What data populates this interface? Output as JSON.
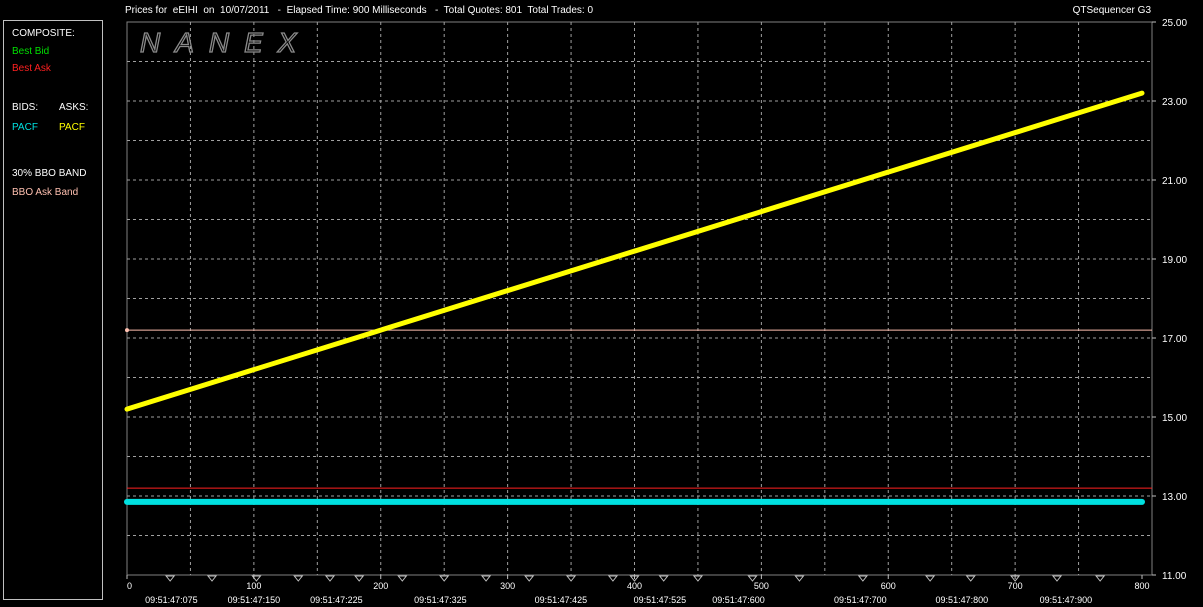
{
  "header": {
    "title": "Prices for  eEIHI  on  10/07/2011   -  Elapsed Time: 900 Milliseconds   -  Total Quotes: 801  Total Trades: 0",
    "app_name": "QTSequencer G3"
  },
  "watermark": "NANEX",
  "legend": {
    "composite_heading": "COMPOSITE:",
    "best_bid": "Best Bid",
    "best_ask": "Best Ask",
    "bids_heading": "BIDS:",
    "asks_heading": "ASKS:",
    "bid_exchange": "PACF",
    "ask_exchange": "PACF",
    "band_heading": "30% BBO BAND",
    "band_item": "BBO Ask Band"
  },
  "colors": {
    "best_bid": "#00e000",
    "best_ask": "#ff2020",
    "bid_series": "#00e0e0",
    "ask_series": "#ffff00",
    "band": "#ffc0b0",
    "grid": "#a0a0a0"
  },
  "chart_data": {
    "type": "line",
    "x_axis_label": "",
    "y_axis_label": "",
    "xlim": [
      0,
      800
    ],
    "ylim": [
      11,
      25
    ],
    "x_ticks": [
      0,
      100,
      200,
      300,
      400,
      500,
      600,
      700,
      800
    ],
    "y_ticks": [
      "11.00",
      "13.00",
      "15.00",
      "17.00",
      "19.00",
      "21.00",
      "23.00",
      "25.00"
    ],
    "time_labels": [
      {
        "x": 35,
        "label": "09:51:47:075"
      },
      {
        "x": 100,
        "label": "09:51:47:150"
      },
      {
        "x": 165,
        "label": "09:51:47:225"
      },
      {
        "x": 247,
        "label": "09:51:47:325"
      },
      {
        "x": 342,
        "label": "09:51:47:425"
      },
      {
        "x": 420,
        "label": "09:51:47:525"
      },
      {
        "x": 482,
        "label": "09:51:47:600"
      },
      {
        "x": 578,
        "label": "09:51:47:700"
      },
      {
        "x": 658,
        "label": "09:51:47:800"
      },
      {
        "x": 740,
        "label": "09:51:47:900"
      }
    ],
    "trade_markers_x": [
      34,
      67,
      102,
      135,
      160,
      183,
      217,
      250,
      283,
      317,
      350,
      383,
      400,
      423,
      450,
      493,
      530,
      580,
      633,
      665,
      700,
      733,
      767
    ],
    "series": [
      {
        "name": "PACF",
        "side": "ask",
        "x": [
          0,
          800
        ],
        "y": [
          15.2,
          23.2
        ]
      },
      {
        "name": "PACF",
        "side": "bid",
        "x": [
          0,
          800
        ],
        "y": [
          12.85,
          12.85
        ]
      },
      {
        "name": "Best Ask",
        "x": [
          0,
          800
        ],
        "y": [
          13.2,
          13.2
        ]
      },
      {
        "name": "BBO Ask Band",
        "x": [
          0,
          800
        ],
        "y": [
          17.2,
          17.2
        ]
      }
    ]
  }
}
